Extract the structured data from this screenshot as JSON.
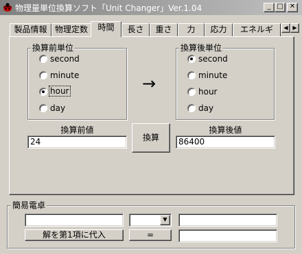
{
  "window": {
    "title": "物理量単位換算ソフト「Unit Changer」Ver.1.04",
    "controls": {
      "minimize": "_",
      "maximize": "□",
      "close": "✕"
    }
  },
  "tabs": [
    "製品情報",
    "物理定数",
    "時間",
    "長さ",
    "重さ",
    "力",
    "応力",
    "エネルギ"
  ],
  "active_tab": "時間",
  "tab_scroll": {
    "left": "◀",
    "right": "▶"
  },
  "converter": {
    "source_group_label": "換算前単位",
    "target_group_label": "換算後単位",
    "source_units": [
      "second",
      "minute",
      "hour",
      "day"
    ],
    "target_units": [
      "second",
      "minute",
      "hour",
      "day"
    ],
    "source_selected": "hour",
    "target_selected": "second",
    "arrow": "→",
    "input_label": "換算前値",
    "input_value": "24",
    "convert_button": "換算",
    "output_label": "換算後値",
    "output_value": "86400"
  },
  "calculator": {
    "group_label": "簡易電卓",
    "operand1": "",
    "operator": "",
    "operand2": "",
    "assign_button": "解を第1項に代入",
    "equals_button": "=",
    "result": "",
    "dropdown_arrow": "▼"
  }
}
